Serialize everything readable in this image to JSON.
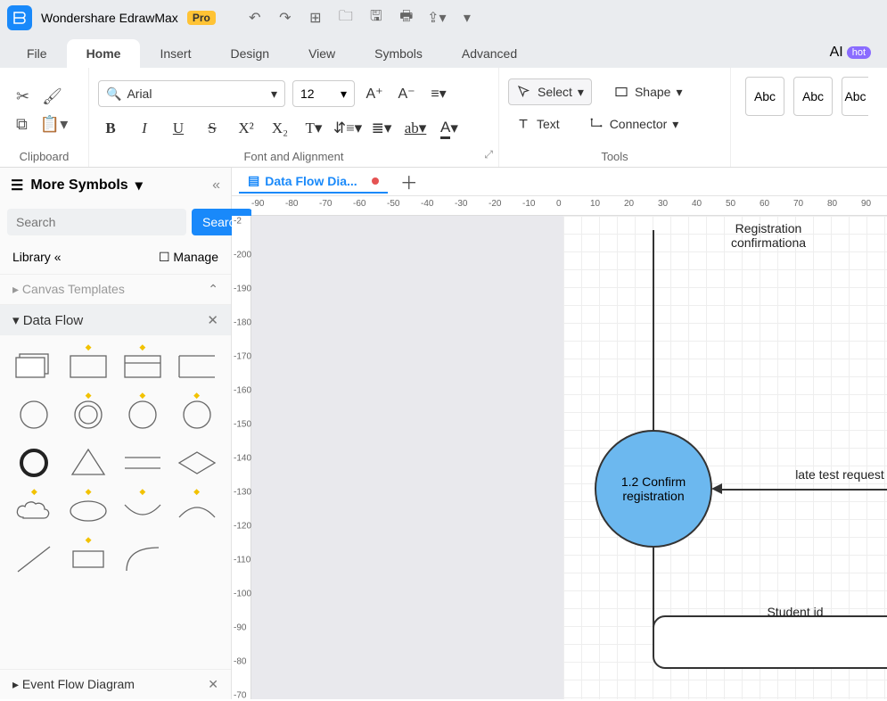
{
  "title": "Wondershare EdrawMax",
  "badge": "Pro",
  "menus": {
    "file": "File",
    "home": "Home",
    "insert": "Insert",
    "design": "Design",
    "view": "View",
    "symbols": "Symbols",
    "advanced": "Advanced",
    "ai": "AI",
    "hot": "hot"
  },
  "ribbon": {
    "clipboard_label": "Clipboard",
    "font_label": "Font and Alignment",
    "tools_label": "Tools",
    "font_name": "Arial",
    "font_size": "12",
    "select": "Select",
    "shape": "Shape",
    "text": "Text",
    "connector": "Connector",
    "abc": "Abc"
  },
  "sidebar": {
    "more_symbols": "More Symbols",
    "search_ph": "Search",
    "search_btn": "Search",
    "library": "Library",
    "manage": "Manage",
    "canvas_templates": "Canvas Templates",
    "data_flow": "Data Flow",
    "event_flow": "Event Flow Diagram"
  },
  "doc": {
    "tab_name": "Data Flow Dia..."
  },
  "ruler_h": [
    "-90",
    "-80",
    "-70",
    "-60",
    "-50",
    "-40",
    "-30",
    "-20",
    "-10",
    "0",
    "10",
    "20",
    "30",
    "40",
    "50",
    "60",
    "70",
    "80",
    "90"
  ],
  "ruler_v": [
    "-2",
    "-200",
    "-190",
    "-180",
    "-170",
    "-160",
    "-150",
    "-140",
    "-130",
    "-120",
    "-110",
    "-100",
    "-90",
    "-80",
    "-70"
  ],
  "dfd": {
    "confirm": "1.2 Confirm registration",
    "reg_conf": "Registration confirmationa",
    "late_test": "late test request",
    "student_id": "Student id"
  }
}
